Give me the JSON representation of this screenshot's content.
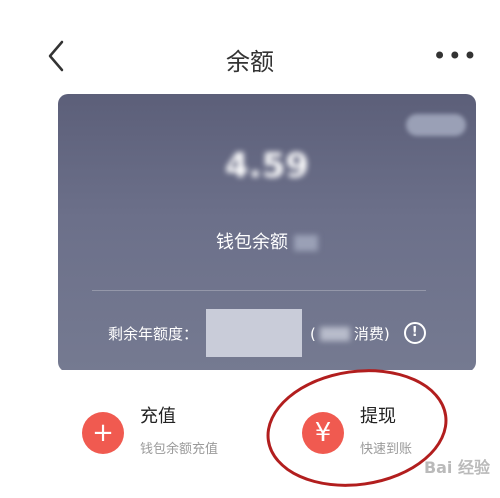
{
  "header": {
    "title": "余额",
    "more_label": "•••"
  },
  "card": {
    "balance": "4.59",
    "balance_label": "钱包余额",
    "quota_label": "剩余年额度：",
    "quota_open_paren": "(",
    "quota_consume": "消费)",
    "info_icon": "info-icon",
    "colors": {
      "top": "#5c5f79",
      "bottom": "#757a91"
    }
  },
  "actions": [
    {
      "title": "充值",
      "subtitle": "钱包余额充值",
      "icon": "plus-icon",
      "glyph": "+",
      "color": "#f05a50"
    },
    {
      "title": "提现",
      "subtitle": "快速到账",
      "icon": "yen-icon",
      "glyph": "¥",
      "color": "#f05a50"
    }
  ],
  "watermark": "Bai 经验"
}
